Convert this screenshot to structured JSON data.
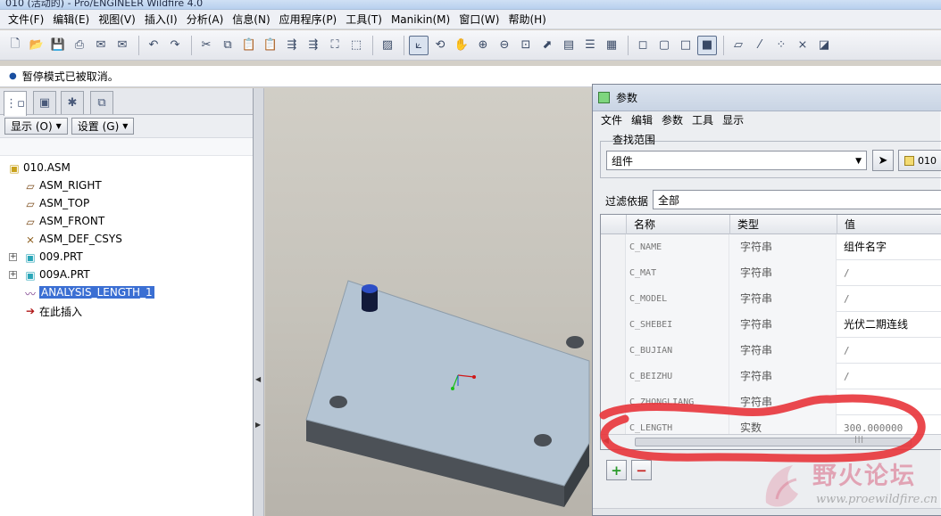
{
  "window": {
    "title": "010 (活动的) - Pro/ENGINEER Wildfire 4.0"
  },
  "menubar": {
    "items": [
      "文件(F)",
      "编辑(E)",
      "视图(V)",
      "插入(I)",
      "分析(A)",
      "信息(N)",
      "应用程序(P)",
      "工具(T)",
      "Manikin(M)",
      "窗口(W)",
      "帮助(H)"
    ]
  },
  "toolbar": {
    "icons": [
      "new-icon",
      "open-icon",
      "save-icon",
      "print-icon",
      "email-icon",
      "email-link-icon",
      "undo-icon",
      "redo-icon",
      "cut-icon",
      "copy-icon",
      "paste-icon",
      "paste-special-icon",
      "regenerate-icon",
      "regenerate-manager-icon",
      "find-icon",
      "select-box-icon",
      "repaint-icon",
      "spin-center-icon",
      "orient-mode-icon",
      "pan-icon",
      "zoom-in-icon",
      "zoom-out-icon",
      "refit-icon",
      "reorient-icon",
      "saved-views-icon",
      "layers-icon",
      "view-manager-icon",
      "wireframe-icon",
      "hidden-line-icon",
      "no-hidden-icon",
      "shaded-icon",
      "datum-planes-icon",
      "datum-axes-icon",
      "datum-points-icon",
      "csys-icon",
      "annotations-icon"
    ],
    "active_icons": [
      "spin-center-icon",
      "shaded-icon"
    ]
  },
  "message": {
    "text": "暂停模式已被取消。"
  },
  "left_panel": {
    "tabs": [
      "model-tree-tab",
      "folder-browser-tab",
      "favorites-tab",
      "connections-tab"
    ],
    "show_button": "显示 (O)",
    "settings_button": "设置 (G)",
    "tree": [
      {
        "label": "010.ASM",
        "icon": "assembly-icon",
        "level": 0,
        "expandable": false,
        "selected": false
      },
      {
        "label": "ASM_RIGHT",
        "icon": "datum-plane-icon",
        "level": 1,
        "expandable": false,
        "selected": false
      },
      {
        "label": "ASM_TOP",
        "icon": "datum-plane-icon",
        "level": 1,
        "expandable": false,
        "selected": false
      },
      {
        "label": "ASM_FRONT",
        "icon": "datum-plane-icon",
        "level": 1,
        "expandable": false,
        "selected": false
      },
      {
        "label": "ASM_DEF_CSYS",
        "icon": "csys-icon",
        "level": 1,
        "expandable": false,
        "selected": false
      },
      {
        "label": "009.PRT",
        "icon": "part-icon",
        "level": 1,
        "expandable": true,
        "selected": false
      },
      {
        "label": "009A.PRT",
        "icon": "part-icon",
        "level": 1,
        "expandable": true,
        "selected": false
      },
      {
        "label": "ANALYSIS_LENGTH_1",
        "icon": "analysis-icon",
        "level": 1,
        "expandable": false,
        "selected": true
      },
      {
        "label": "在此插入",
        "icon": "insert-here-arrow-icon",
        "level": 1,
        "expandable": false,
        "selected": false
      }
    ]
  },
  "parameters_dialog": {
    "title": "参数",
    "menu": [
      "文件",
      "编辑",
      "参数",
      "工具",
      "显示"
    ],
    "look_in_label": "查找范围",
    "look_in_value": "组件",
    "model_button": "010",
    "filter_label": "过滤依据",
    "filter_value": "全部",
    "columns": [
      "名称",
      "类型",
      "值"
    ],
    "rows": [
      {
        "name": "C_NAME",
        "type": "字符串",
        "value": "组件名字"
      },
      {
        "name": "C_MAT",
        "type": "字符串",
        "value": "/"
      },
      {
        "name": "C_MODEL",
        "type": "字符串",
        "value": "/"
      },
      {
        "name": "C_SHEBEI",
        "type": "字符串",
        "value": "光伏二期连线"
      },
      {
        "name": "C_BUJIAN",
        "type": "字符串",
        "value": "/"
      },
      {
        "name": "C_BEIZHU",
        "type": "字符串",
        "value": "/"
      },
      {
        "name": "C_ZHONGLIANG",
        "type": "字符串",
        "value": ""
      },
      {
        "name": "C_LENGTH",
        "type": "实数",
        "value": "300.000000"
      }
    ],
    "add_button": "+",
    "delete_button": "−"
  },
  "watermark": {
    "text": "野火论坛",
    "url": "www.proewildfire.cn"
  },
  "colors": {
    "annotation": "#e8343a",
    "selection": "#3b6fd3",
    "add": "#2a9a2a",
    "delete": "#c62424"
  }
}
